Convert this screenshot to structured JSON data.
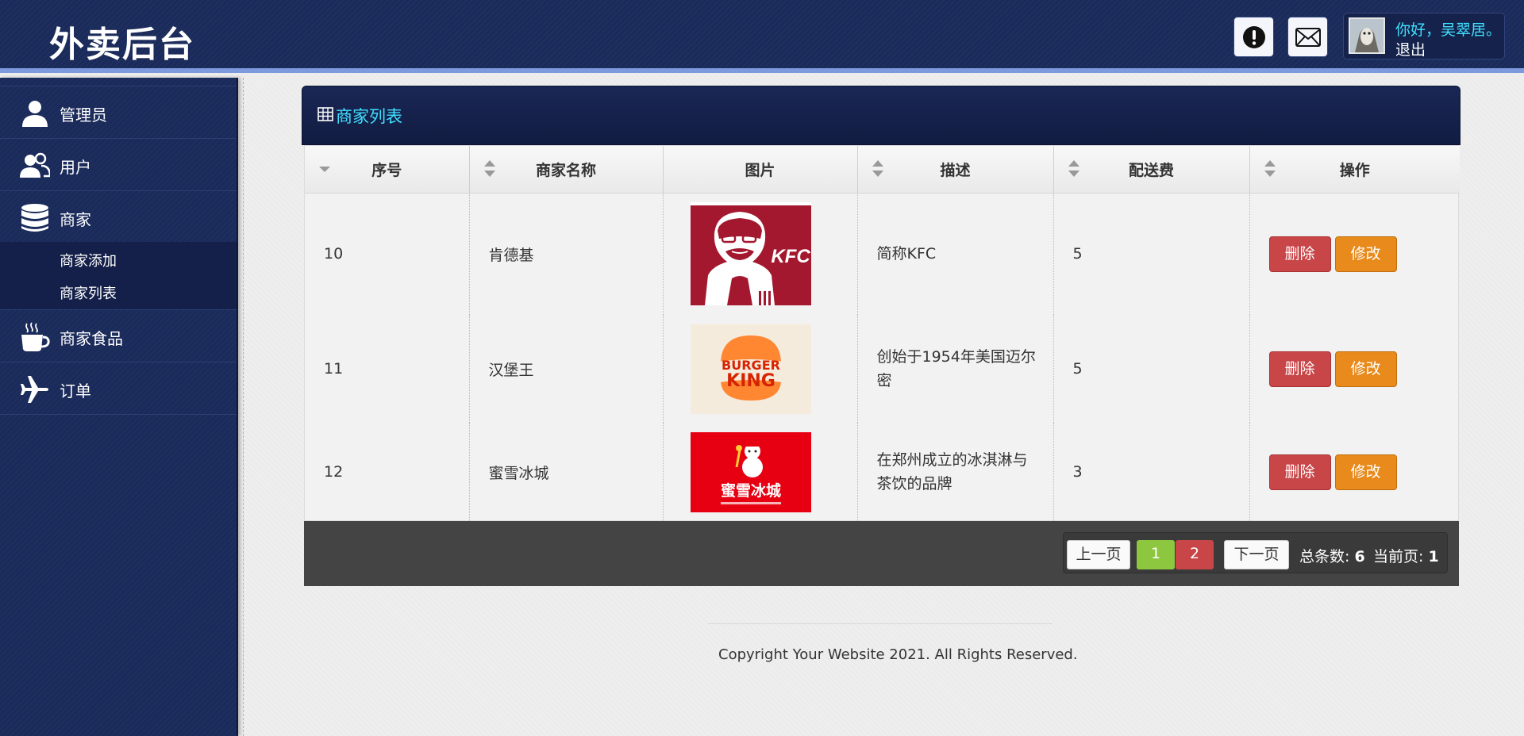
{
  "header": {
    "logo": "外卖后台",
    "alert_icon": "exclamation-circle-icon",
    "mail_icon": "envelope-icon",
    "user": {
      "greeting": "你好，吴翠居。",
      "logout": "退出"
    }
  },
  "sidebar": {
    "items": [
      {
        "label": "管理员",
        "icon": "user-icon"
      },
      {
        "label": "用户",
        "icon": "users-icon"
      },
      {
        "label": "商家",
        "icon": "database-icon"
      },
      {
        "label": "商家食品",
        "icon": "coffee-cup-icon"
      },
      {
        "label": "订单",
        "icon": "airplane-icon"
      }
    ],
    "submenu": [
      "商家添加",
      "商家列表"
    ]
  },
  "panel": {
    "title": "商家列表",
    "columns": [
      "序号",
      "商家名称",
      "图片",
      "描述",
      "配送费",
      "操作"
    ],
    "rows": [
      {
        "id": "10",
        "name": "肯德基",
        "image": "kfc-logo",
        "desc": "简称KFC",
        "fee": "5"
      },
      {
        "id": "11",
        "name": "汉堡王",
        "image": "burger-king-logo",
        "desc": "创始于1954年美国迈尔密",
        "fee": "5"
      },
      {
        "id": "12",
        "name": "蜜雪冰城",
        "image": "mixue-logo",
        "desc": "在郑州成立的冰淇淋与茶饮的品牌",
        "fee": "3"
      }
    ],
    "actions": {
      "delete": "删除",
      "edit": "修改"
    }
  },
  "pager": {
    "prev": "上一页",
    "pages": [
      "1",
      "2"
    ],
    "next": "下一页",
    "total_label": "总条数:",
    "total": "6",
    "current_label": "当前页:",
    "current": "1"
  },
  "footer": {
    "copyright": "Copyright Your Website 2021. All Rights Reserved."
  },
  "colors": {
    "navy": "#1a2a5a",
    "accent_cyan": "#3fe0ff",
    "danger": "#c84548",
    "warning": "#e88a1c",
    "success": "#8dc63f"
  }
}
